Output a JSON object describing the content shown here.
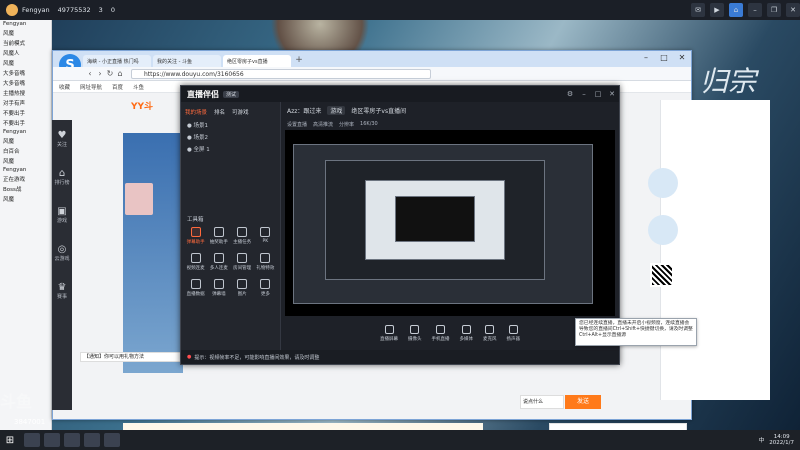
{
  "topbar": {
    "user": "Fengyan",
    "id": "49775532",
    "stat1": "3",
    "stat2": "0"
  },
  "leftpanel": {
    "lines": [
      "Fengyan",
      "风魔",
      "当前模式",
      "风魔人",
      "风魔",
      "大多音嘴",
      "大多音嘴",
      "主播热搜",
      "对手有声",
      "不要出手",
      "不要出手",
      "Fengyan",
      "风魔",
      "白百合",
      "风魔",
      "Fengyan",
      "正在游戏",
      "Boss战",
      "风魔"
    ]
  },
  "sidenav": {
    "items": [
      {
        "glyph": "♥",
        "label": "关注"
      },
      {
        "glyph": "⌂",
        "label": "排行榜"
      },
      {
        "glyph": "▣",
        "label": "游戏"
      },
      {
        "glyph": "◎",
        "label": "云游戏"
      },
      {
        "glyph": "♛",
        "label": "赛事"
      }
    ]
  },
  "browser": {
    "tabs": [
      "海峡 - 小正直播 热门吗",
      "我的关注 - 斗鱼",
      "绝区零房子vs直播"
    ],
    "url": "https://www.douyu.com/3160656",
    "bookmarks": [
      "收藏",
      "网址导航",
      "百度",
      "斗鱼"
    ],
    "douyu_logo": "YY斗"
  },
  "assistant": {
    "logo": "直播伴侣",
    "version": "测试",
    "tabs": [
      "我的场景",
      "排名",
      "可游戏"
    ],
    "scenes": [
      "● 场景1",
      "● 场景2",
      "● 全屏 1"
    ],
    "tools_title": "工具箱",
    "tools": [
      {
        "label": "弹幕助手",
        "hot": true
      },
      {
        "label": "抽奖助手",
        "hot": false
      },
      {
        "label": "主播任务",
        "hot": false
      },
      {
        "label": "PK",
        "hot": false
      },
      {
        "label": "视频连麦",
        "hot": false
      },
      {
        "label": "多人连麦",
        "hot": false
      },
      {
        "label": "房间管理",
        "hot": false
      },
      {
        "label": "礼物特效",
        "hot": false
      },
      {
        "label": "直播数据",
        "hot": false
      },
      {
        "label": "弹幕墙",
        "hot": false
      },
      {
        "label": "图片",
        "hot": false
      },
      {
        "label": "更多",
        "hot": false
      }
    ],
    "header": {
      "room": "Azz：跟过来",
      "pill1": "游戏",
      "stream_title": "绝区零房子vs直播间"
    },
    "subheader": [
      "设置直播",
      "高清推流",
      "分辨率",
      "16K/30"
    ],
    "bottom_buttons": [
      "直播屏幕",
      "摄像头",
      "手机直播",
      "多媒体",
      "麦克风",
      "扬声器"
    ],
    "status": "提示：视频帧率不足，可能影响直播间效果，请及时调整",
    "status_warn": "●"
  },
  "tooltip": {
    "text": "您已经连续直播，直播未开启小视频窗，连续直播会导致您的直播间Ctrl+Shift+快捷键切换，请及时调整Ctrl+Alt+显示直播源"
  },
  "page": {
    "bigtitle": "归宗",
    "footer_input": "【通知】你可以用礼物方法",
    "danmu_input": "说点什么",
    "danmu_send": "发送"
  },
  "watermark": {
    "text": "斗鱼",
    "room": "3847001"
  },
  "taskbar": {
    "tray_lang": "中",
    "time": "14:09",
    "date": "2022/1/7"
  }
}
